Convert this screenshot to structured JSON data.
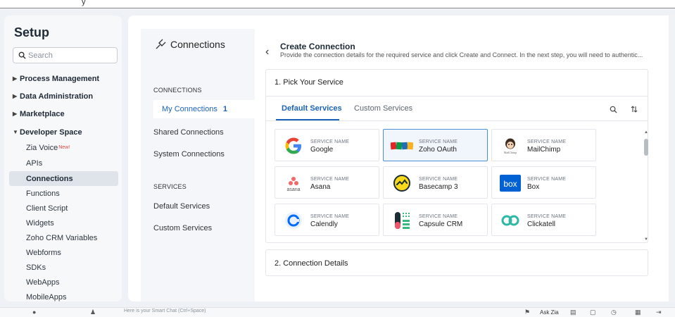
{
  "topbar": {
    "fragment": "y"
  },
  "sidebar": {
    "title": "Setup",
    "search_placeholder": "Search",
    "groups": [
      {
        "label": "Process Management",
        "expanded": false
      },
      {
        "label": "Data Administration",
        "expanded": false
      },
      {
        "label": "Marketplace",
        "expanded": false
      },
      {
        "label": "Developer Space",
        "expanded": true
      }
    ],
    "dev_items": [
      {
        "label": "Zia Voice",
        "badge": "New!"
      },
      {
        "label": "APIs"
      },
      {
        "label": "Connections",
        "active": true
      },
      {
        "label": "Functions"
      },
      {
        "label": "Client Script"
      },
      {
        "label": "Widgets"
      },
      {
        "label": "Zoho CRM Variables"
      },
      {
        "label": "Webforms"
      },
      {
        "label": "SDKs"
      },
      {
        "label": "WebApps"
      },
      {
        "label": "MobileApps"
      }
    ]
  },
  "connections_panel": {
    "title": "Connections",
    "section_connections": "CONNECTIONS",
    "my_connections": "My Connections",
    "my_connections_count": "1",
    "shared_connections": "Shared Connections",
    "system_connections": "System Connections",
    "section_services": "SERVICES",
    "default_services": "Default Services",
    "custom_services": "Custom Services"
  },
  "create": {
    "title": "Create Connection",
    "description": "Provide the connection details for the required service and click Create and Connect. In the next step, you will need to authentic...",
    "step1": "1. Pick Your Service",
    "tab_default": "Default Services",
    "tab_custom": "Custom Services",
    "service_label": "SERVICE NAME",
    "services": [
      {
        "name": "Google",
        "icon": "google-logo",
        "selected": false
      },
      {
        "name": "Zoho OAuth",
        "icon": "zoho-logo",
        "selected": true
      },
      {
        "name": "MailChimp",
        "icon": "mailchimp-logo",
        "selected": false
      },
      {
        "name": "Asana",
        "icon": "asana-logo",
        "selected": false
      },
      {
        "name": "Basecamp 3",
        "icon": "basecamp-logo",
        "selected": false
      },
      {
        "name": "Box",
        "icon": "box-logo",
        "selected": false
      },
      {
        "name": "Calendly",
        "icon": "calendly-logo",
        "selected": false
      },
      {
        "name": "Capsule CRM",
        "icon": "capsule-logo",
        "selected": false
      },
      {
        "name": "Clickatell",
        "icon": "clickatell-logo",
        "selected": false
      }
    ],
    "step2": "2. Connection Details"
  },
  "bottombar": {
    "hint": "Here is your Smart Chat (Ctrl+Space)",
    "ask_zia": "Ask Zia"
  },
  "colors": {
    "accent": "#1a63b8",
    "selected_border": "#4a90d9",
    "sidebar_active_bg": "#dfe4eb"
  }
}
